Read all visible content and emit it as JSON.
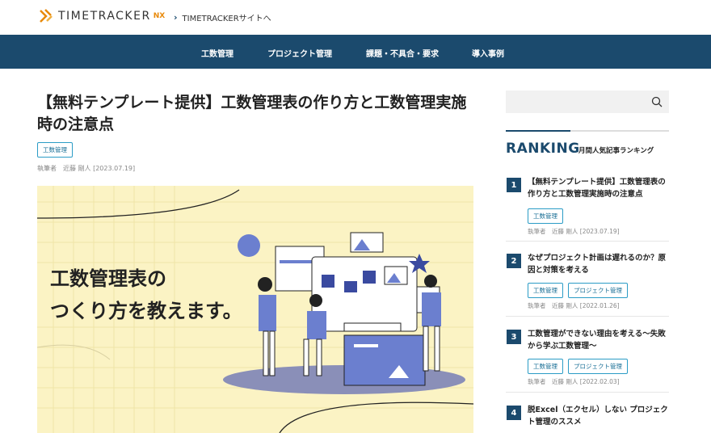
{
  "header": {
    "logo_text": "TIMETRACKER",
    "logo_suffix": "NX",
    "site_link": "TIMETRACKERサイトへ"
  },
  "nav": [
    "工数管理",
    "プロジェクト管理",
    "課題・不具合・要求",
    "導入事例"
  ],
  "article": {
    "title": "【無料テンプレート提供】工数管理表の作り方と工数管理実施時の注意点",
    "tag": "工数管理",
    "byline": "執筆者　近藤 剛人 [2023.07.19]",
    "hero_line1": "工数管理表の",
    "hero_line2": "つくり方を教えます。"
  },
  "sidebar": {
    "ranking_title": "RANKING",
    "ranking_subtitle": "月間人気記事ランキング",
    "items": [
      {
        "num": "1",
        "title": "【無料テンプレート提供】工数管理表の作り方と工数管理実施時の注意点",
        "tags": [
          "工数管理"
        ],
        "meta": "執筆者　近藤 剛人 [2023.07.19]"
      },
      {
        "num": "2",
        "title": "なぜプロジェクト計画は遅れるのか？原因と対策を考える",
        "tags": [
          "工数管理",
          "プロジェクト管理"
        ],
        "meta": "執筆者　近藤 剛人 [2022.01.26]"
      },
      {
        "num": "3",
        "title": "工数管理ができない理由を考える〜失敗から学ぶ工数管理〜",
        "tags": [
          "工数管理",
          "プロジェクト管理"
        ],
        "meta": "執筆者　近藤 剛人 [2022.02.03]"
      },
      {
        "num": "4",
        "title": "脱Excel（エクセル）しない プロジェクト管理のススメ",
        "tags": [],
        "meta": ""
      }
    ]
  },
  "colors": {
    "nav_bg": "#1b4a6d",
    "accent": "#e8890a",
    "tag_border": "#2b9cc6",
    "hero_bg": "#fbf3c4"
  },
  "icons": [
    "logo-mark-icon",
    "chevron-right-icon",
    "search-icon"
  ]
}
